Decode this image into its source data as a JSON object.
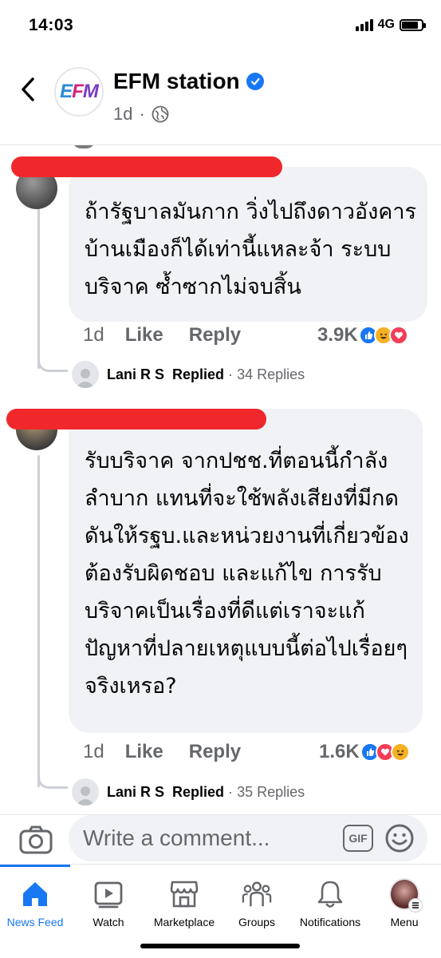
{
  "status_bar": {
    "time": "14:03",
    "network": "4G"
  },
  "header": {
    "page_name": "EFM station",
    "logo_text": "EFM",
    "post_age": "1d",
    "separator": "·"
  },
  "comments": [
    {
      "text": "ถ้ารัฐบาลมันกาก วิ่งไปถึงดาวอังคาร บ้านเมืองก็ได้เท่านี้แหละจ้า ระบบบริจาค ซ้ำซากไม่จบสิ้น",
      "time": "1d",
      "like_label": "Like",
      "reply_label": "Reply",
      "reaction_count": "3.9K",
      "reactions": [
        "like",
        "haha",
        "love"
      ],
      "replies": {
        "name": "Lani R S",
        "verb": "Replied",
        "dot": "·",
        "count": "34 Replies"
      }
    },
    {
      "text": "รับบริจาค จากปชช.ที่ตอนนี้กำลังลำบาก แทนที่จะใช้พลังเสียงที่มีกดดันให้รฐบ.และหน่วยงานที่เกี่ยวข้องต้องรับผิดชอบ และแก้ไข การรับบริจาคเป็นเรื่องที่ดีแต่เราจะแก้ปัญหาที่ปลายเหตุแบบนี้ต่อไปเรื่อยๆจริงเหรอ?",
      "time": "1d",
      "like_label": "Like",
      "reply_label": "Reply",
      "reaction_count": "1.6K",
      "reactions": [
        "like",
        "love",
        "haha"
      ],
      "replies": {
        "name": "Lani R S",
        "verb": "Replied",
        "dot": "·",
        "count": "35 Replies"
      }
    }
  ],
  "composer": {
    "placeholder": "Write a comment...",
    "gif_label": "GIF"
  },
  "tabs": [
    {
      "label": "News Feed",
      "icon": "home-icon",
      "active": true
    },
    {
      "label": "Watch",
      "icon": "watch-icon",
      "active": false
    },
    {
      "label": "Marketplace",
      "icon": "marketplace-icon",
      "active": false
    },
    {
      "label": "Groups",
      "icon": "groups-icon",
      "active": false
    },
    {
      "label": "Notifications",
      "icon": "bell-icon",
      "active": false
    },
    {
      "label": "Menu",
      "icon": "profile-avatar-icon",
      "active": false
    }
  ],
  "colors": {
    "accent": "#1877f2",
    "bubble": "#f0f2f5",
    "secondary_text": "#65676b",
    "redaction": "#f0282b"
  }
}
